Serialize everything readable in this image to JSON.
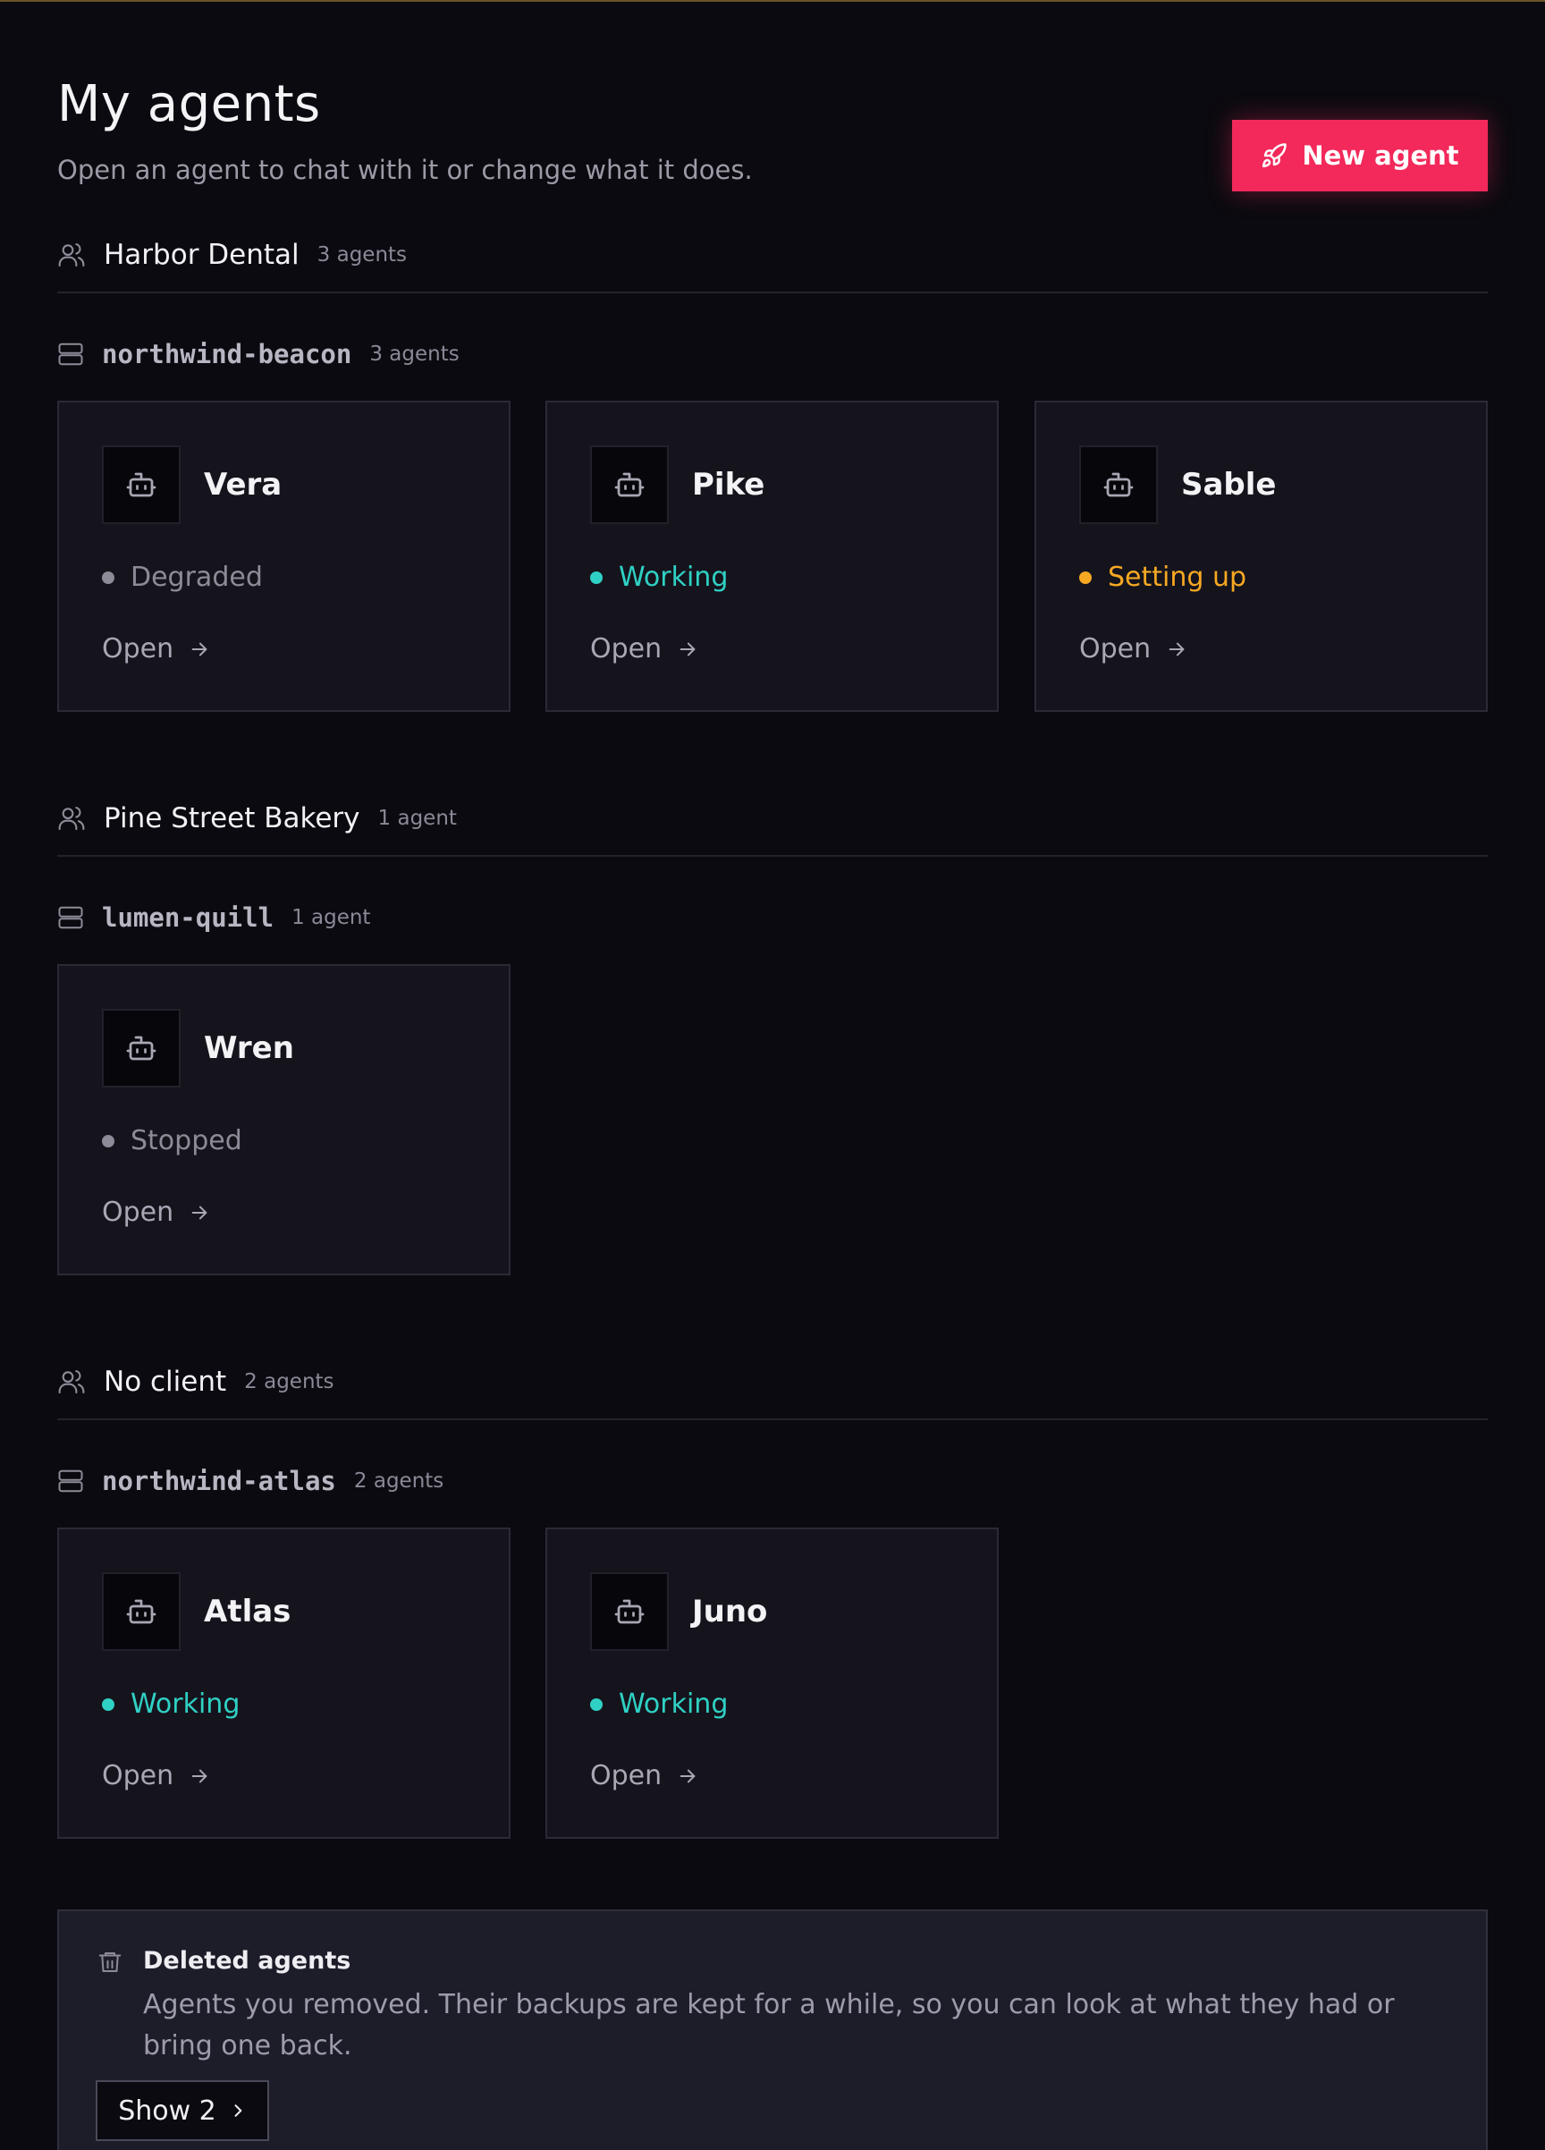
{
  "header": {
    "title": "My agents",
    "subtitle": "Open an agent to chat with it or change what it does.",
    "new_agent_label": "New agent"
  },
  "colors": {
    "accent": "#f2295a",
    "working": "#2fd1c4",
    "setting_up": "#f7a823",
    "inactive": "#8d8b97"
  },
  "groups": [
    {
      "client": "Harbor Dental",
      "count": "3 agents",
      "server": "northwind-beacon",
      "server_count": "3 agents",
      "agents": [
        {
          "name": "Vera",
          "status": "Degraded",
          "status_kind": "inactive",
          "open_label": "Open"
        },
        {
          "name": "Pike",
          "status": "Working",
          "status_kind": "working",
          "open_label": "Open"
        },
        {
          "name": "Sable",
          "status": "Setting up",
          "status_kind": "setting_up",
          "open_label": "Open"
        }
      ]
    },
    {
      "client": "Pine Street Bakery",
      "count": "1 agent",
      "server": "lumen-quill",
      "server_count": "1 agent",
      "agents": [
        {
          "name": "Wren",
          "status": "Stopped",
          "status_kind": "inactive",
          "open_label": "Open"
        }
      ]
    },
    {
      "client": "No client",
      "count": "2 agents",
      "server": "northwind-atlas",
      "server_count": "2 agents",
      "agents": [
        {
          "name": "Atlas",
          "status": "Working",
          "status_kind": "working",
          "open_label": "Open"
        },
        {
          "name": "Juno",
          "status": "Working",
          "status_kind": "working",
          "open_label": "Open"
        }
      ]
    }
  ],
  "deleted": {
    "title": "Deleted agents",
    "description": "Agents you removed. Their backups are kept for a while, so you can look at what they had or bring one back.",
    "show_label": "Show 2"
  }
}
